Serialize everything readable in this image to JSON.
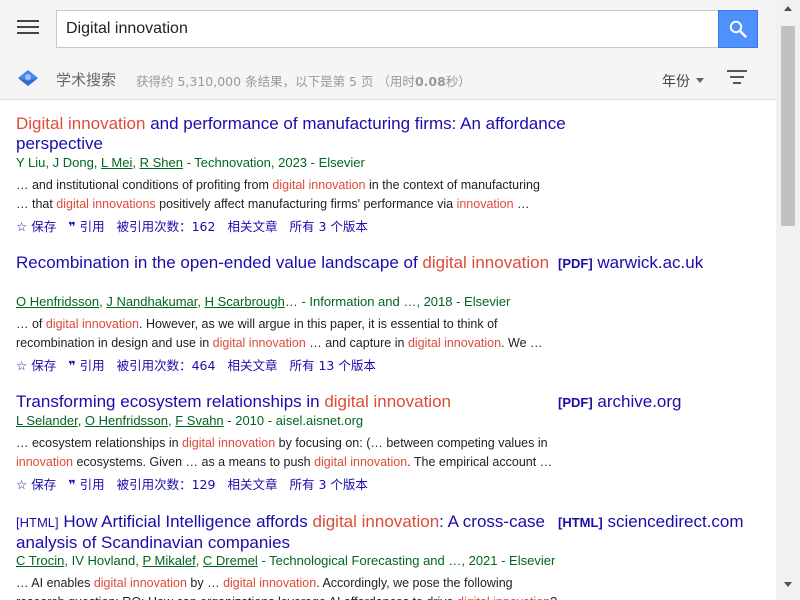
{
  "search": {
    "query": "Digital innovation"
  },
  "header": {
    "scholar_label": "学术搜索",
    "stats_prefix": "获得约 5,310,000 条结果，以下是第 5 页 （用时",
    "stats_time": "0.08",
    "stats_suffix": "秒）",
    "year_label": "年份"
  },
  "colors": {
    "link": "#1a0dab",
    "highlight": "#dd4b39",
    "meta": "#006621",
    "search_button": "#4d90fe"
  },
  "results": [
    {
      "title_parts": [
        {
          "text": "Digital innovation",
          "hl": true
        },
        {
          "text": " and performance of manufacturing firms: An affordance perspective",
          "hl": false
        }
      ],
      "side": null,
      "meta_parts": [
        {
          "text": "Y Liu, J Dong, ",
          "link": false
        },
        {
          "text": "L Mei",
          "link": true
        },
        {
          "text": ", ",
          "link": false
        },
        {
          "text": "R Shen",
          "link": true
        },
        {
          "text": " - Technovation, 2023 - Elsevier",
          "link": false
        }
      ],
      "snippet_lines": [
        [
          {
            "text": "… and institutional conditions of profiting from ",
            "hl": false
          },
          {
            "text": "digital innovation",
            "hl": true
          },
          {
            "text": " in the context of manufacturing",
            "hl": false
          }
        ],
        [
          {
            "text": "… that ",
            "hl": false
          },
          {
            "text": "digital innovations",
            "hl": true
          },
          {
            "text": " positively affect manufacturing firms' performance via ",
            "hl": false
          },
          {
            "text": "innovation",
            "hl": true
          },
          {
            "text": " …",
            "hl": false
          }
        ]
      ],
      "actions": {
        "save": "保存",
        "cite": "引用",
        "cited_by": "被引用次数：162",
        "related": "相关文章",
        "versions": "所有 3 个版本"
      }
    },
    {
      "title_parts": [
        {
          "text": "Recombination in the open-ended value landscape of ",
          "hl": false
        },
        {
          "text": "digital innovation",
          "hl": true
        }
      ],
      "side": {
        "tag": "[PDF]",
        "domain": "warwick.ac.uk"
      },
      "meta_parts": [
        {
          "text": "O Henfridsson",
          "link": true
        },
        {
          "text": ", ",
          "link": false
        },
        {
          "text": "J Nandhakumar",
          "link": true
        },
        {
          "text": ", ",
          "link": false
        },
        {
          "text": "H Scarbrough",
          "link": true
        },
        {
          "text": "… - Information and …, 2018 - Elsevier",
          "link": false
        }
      ],
      "snippet_lines": [
        [
          {
            "text": "… of ",
            "hl": false
          },
          {
            "text": "digital innovation",
            "hl": true
          },
          {
            "text": ". However, as we will argue in this paper, it is essential to think of",
            "hl": false
          }
        ],
        [
          {
            "text": "recombination in design and use in ",
            "hl": false
          },
          {
            "text": "digital innovation",
            "hl": true
          },
          {
            "text": " … and capture in ",
            "hl": false
          },
          {
            "text": "digital innovation",
            "hl": true
          },
          {
            "text": ". We …",
            "hl": false
          }
        ]
      ],
      "actions": {
        "save": "保存",
        "cite": "引用",
        "cited_by": "被引用次数：464",
        "related": "相关文章",
        "versions": "所有 13 个版本"
      }
    },
    {
      "title_parts": [
        {
          "text": "Transforming ecosystem relationships in ",
          "hl": false
        },
        {
          "text": "digital innovation",
          "hl": true
        }
      ],
      "side": {
        "tag": "[PDF]",
        "domain": "archive.org"
      },
      "meta_parts": [
        {
          "text": "L Selander",
          "link": true
        },
        {
          "text": ", ",
          "link": false
        },
        {
          "text": "O Henfridsson",
          "link": true
        },
        {
          "text": ", ",
          "link": false
        },
        {
          "text": "F Svahn",
          "link": true
        },
        {
          "text": " - 2010 - aisel.aisnet.org",
          "link": false
        }
      ],
      "snippet_lines": [
        [
          {
            "text": "… ecosystem relationships in ",
            "hl": false
          },
          {
            "text": "digital innovation",
            "hl": true
          },
          {
            "text": " by focusing on: (… between competing values in",
            "hl": false
          }
        ],
        [
          {
            "text": "innovation",
            "hl": true
          },
          {
            "text": " ecosystems. Given … as a means to push ",
            "hl": false
          },
          {
            "text": "digital innovation",
            "hl": true
          },
          {
            "text": ". The empirical account …",
            "hl": false
          }
        ]
      ],
      "actions": {
        "save": "保存",
        "cite": "引用",
        "cited_by": "被引用次数：129",
        "related": "相关文章",
        "versions": "所有 3 个版本"
      }
    },
    {
      "title_tag": "[HTML]",
      "title_parts": [
        {
          "text": " How Artificial Intelligence affords ",
          "hl": false
        },
        {
          "text": "digital innovation",
          "hl": true
        },
        {
          "text": ": A cross-case analysis of Scandinavian companies",
          "hl": false
        }
      ],
      "side": {
        "tag": "[HTML]",
        "domain": "sciencedirect.com"
      },
      "meta_parts": [
        {
          "text": "C Trocin",
          "link": true
        },
        {
          "text": ", IV Hovland, ",
          "link": false
        },
        {
          "text": "P Mikalef",
          "link": true
        },
        {
          "text": ", ",
          "link": false
        },
        {
          "text": "C Dremel",
          "link": true
        },
        {
          "text": " - Technological Forecasting and …, 2021 - Elsevier",
          "link": false
        }
      ],
      "snippet_lines": [
        [
          {
            "text": "… AI enables ",
            "hl": false
          },
          {
            "text": "digital innovation",
            "hl": true
          },
          {
            "text": " by … ",
            "hl": false
          },
          {
            "text": "digital innovation",
            "hl": true
          },
          {
            "text": ". Accordingly, we pose the following",
            "hl": false
          }
        ],
        [
          {
            "text": "research question: RQ: How can organizations leverage AI affordances to drive ",
            "hl": false
          },
          {
            "text": "digital innovation",
            "hl": true
          },
          {
            "text": "?",
            "hl": false
          }
        ]
      ],
      "actions": null
    }
  ]
}
